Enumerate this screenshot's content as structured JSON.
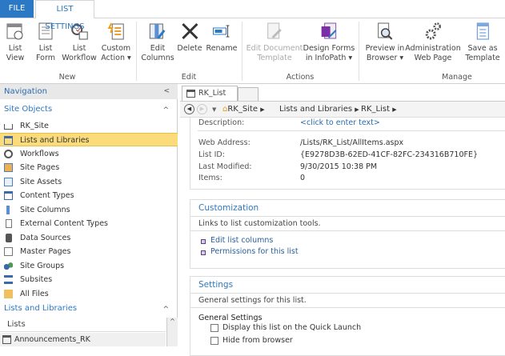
{
  "tabs": {
    "file": "FILE",
    "list_settings": "LIST SETTINGS"
  },
  "ribbon": {
    "groups": [
      "New",
      "Edit",
      "Actions",
      "Manage"
    ],
    "buttons": [
      {
        "l1": "List",
        "l2": "View"
      },
      {
        "l1": "List",
        "l2": "Form"
      },
      {
        "l1": "List",
        "l2": "Workflow"
      },
      {
        "l1": "Custom",
        "l2": "Action ▾"
      },
      {
        "l1": "Edit",
        "l2": "Columns"
      },
      {
        "l1": "Delete",
        "l2": ""
      },
      {
        "l1": "Rename",
        "l2": ""
      },
      {
        "l1": "Edit Document",
        "l2": "Template"
      },
      {
        "l1": "Design Forms",
        "l2": "in InfoPath ▾"
      },
      {
        "l1": "Preview in",
        "l2": "Browser ▾"
      },
      {
        "l1": "Administration",
        "l2": "Web Page"
      },
      {
        "l1": "Save as",
        "l2": "Template"
      }
    ]
  },
  "nav": {
    "title": "Navigation",
    "collapse": "<",
    "site_objects": "Site Objects",
    "items": [
      "RK_Site",
      "Lists and Libraries",
      "Workflows",
      "Site Pages",
      "Site Assets",
      "Content Types",
      "Site Columns",
      "External Content Types",
      "Data Sources",
      "Master Pages",
      "Site Groups",
      "Subsites",
      "All Files"
    ],
    "lists_libraries": "Lists and Libraries",
    "lists": "Lists",
    "list_items": [
      "Announcements_RK"
    ],
    "up": "^"
  },
  "doc_tab": "RK_List",
  "breadcrumb": [
    "RK_Site",
    "Lists and Libraries",
    "RK_List"
  ],
  "info": {
    "description_label": "Description:",
    "description_value": "<click to enter text>",
    "web_label": "Web Address:",
    "web_value": "/Lists/RK_List/AllItems.aspx",
    "id_label": "List ID:",
    "id_value": "{E9278D3B-62ED-41CF-82FC-234316B710FE}",
    "modified_label": "Last Modified:",
    "modified_value": "9/30/2015 10:38 PM",
    "items_label": "Items:",
    "items_value": "0"
  },
  "customization": {
    "title": "Customization",
    "desc": "Links to list customization tools.",
    "links": [
      "Edit list columns",
      "Permissions for this list"
    ]
  },
  "settings": {
    "title": "Settings",
    "desc": "General settings for this list.",
    "sub": "General Settings",
    "checkboxes": [
      "Display this list on the Quick Launch",
      "Hide from browser"
    ]
  }
}
